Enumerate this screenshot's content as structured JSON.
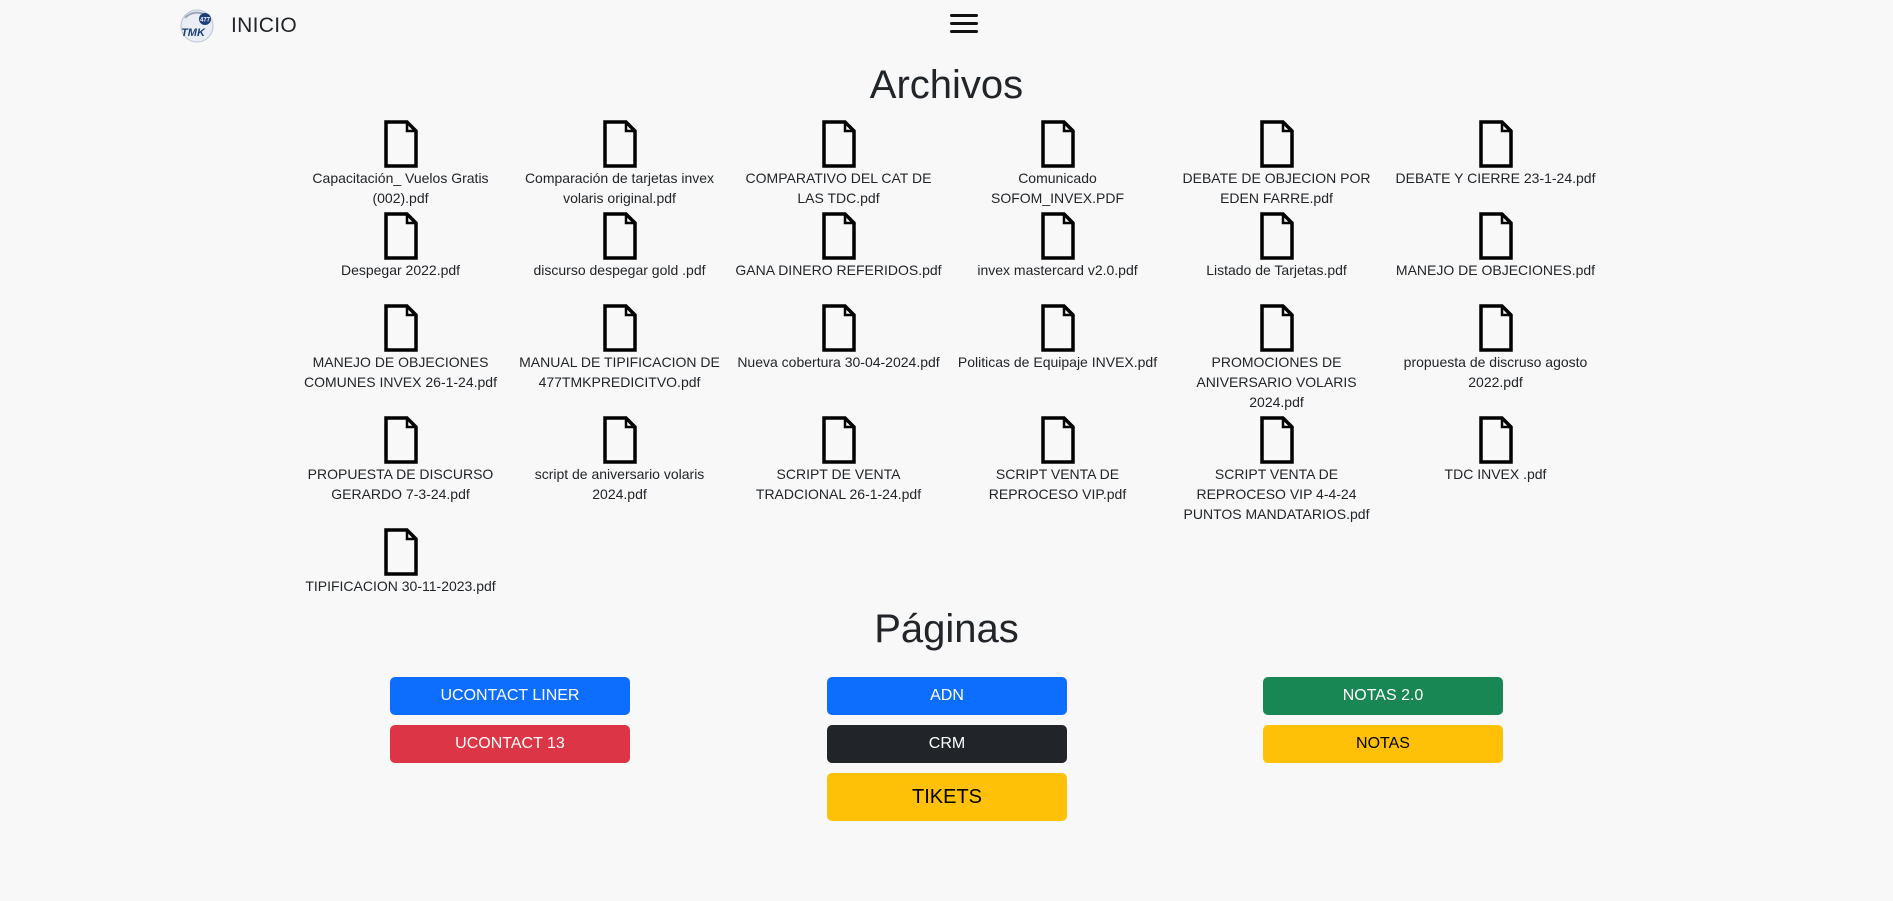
{
  "navbar": {
    "brand_label": "INICIO",
    "logo_text": "477\nTMK"
  },
  "sections": {
    "files_title": "Archivos",
    "pages_title": "Páginas"
  },
  "files": [
    "Capacitación_ Vuelos Gratis (002).pdf",
    "Comparación de tarjetas invex volaris original.pdf",
    "COMPARATIVO DEL CAT DE LAS TDC.pdf",
    "Comunicado SOFOM_INVEX.PDF",
    "DEBATE DE OBJECION POR EDEN FARRE.pdf",
    "DEBATE Y CIERRE 23-1-24.pdf",
    "Despegar 2022.pdf",
    "discurso despegar gold .pdf",
    "GANA DINERO REFERIDOS.pdf",
    "invex mastercard v2.0.pdf",
    "Listado de Tarjetas.pdf",
    "MANEJO DE OBJECIONES.pdf",
    "MANEJO DE OBJECIONES COMUNES INVEX 26-1-24.pdf",
    "MANUAL DE TIPIFICACION DE 477TMKPREDICITVO.pdf",
    "Nueva cobertura 30-04-2024.pdf",
    "Politicas de Equipaje INVEX.pdf",
    "PROMOCIONES DE ANIVERSARIO VOLARIS 2024.pdf",
    "propuesta de discruso agosto 2022.pdf",
    "PROPUESTA DE DISCURSO GERARDO 7-3-24.pdf",
    "script de aniversario volaris 2024.pdf",
    "SCRIPT DE VENTA TRADCIONAL 26-1-24.pdf",
    "SCRIPT VENTA DE REPROCESO VIP.pdf",
    "SCRIPT VENTA DE REPROCESO VIP 4-4-24 PUNTOS MANDATARIOS.pdf",
    "TDC INVEX .pdf",
    "TIPIFICACION 30-11-2023.pdf"
  ],
  "pages": {
    "ucontact_liner": "UCONTACT LINER",
    "ucontact_13": "UCONTACT 13",
    "adn": "ADN",
    "crm": "CRM",
    "tikets": "TIKETS",
    "notas_2": "NOTAS 2.0",
    "notas": "NOTAS"
  },
  "colors": {
    "primary": "#0d6efd",
    "danger": "#dc3545",
    "dark": "#212529",
    "success": "#198754",
    "warning": "#ffc107",
    "background": "#f8f8f8"
  },
  "icons": {
    "file": "file-icon",
    "menu": "hamburger-menu-icon",
    "logo": "477tmk-logo"
  }
}
